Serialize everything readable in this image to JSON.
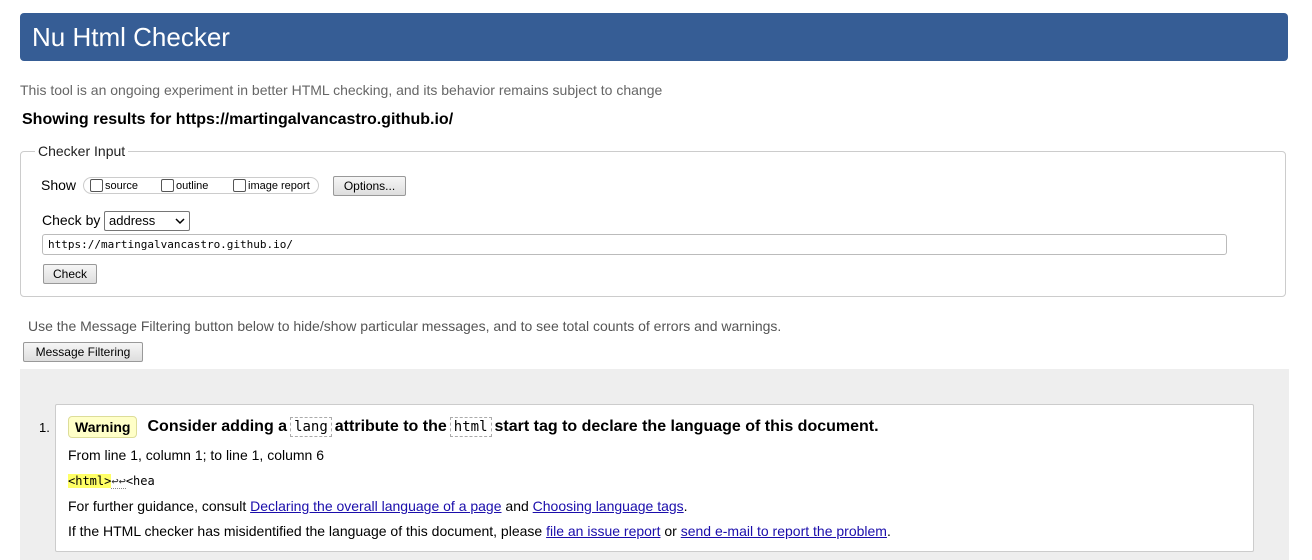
{
  "header": {
    "title": "Nu Html Checker"
  },
  "intro": "This tool is an ongoing experiment in better HTML checking, and its behavior remains subject to change",
  "showing": "Showing results for https://martingalvancastro.github.io/",
  "checker": {
    "legend": "Checker Input",
    "show_label": "Show",
    "options": [
      "source",
      "outline",
      "image report"
    ],
    "options_button": "Options...",
    "check_by_label": "Check by",
    "check_by_value": "address",
    "url_value": "https://martingalvancastro.github.io/",
    "check_button": "Check"
  },
  "filter": {
    "note": "Use the Message Filtering button below to hide/show particular messages, and to see total counts of errors and warnings.",
    "button": "Message Filtering"
  },
  "message": {
    "number": "1.",
    "badge": "Warning",
    "title_a": "Consider adding a",
    "code_a": "lang",
    "title_b": "attribute to the",
    "code_b": "html",
    "title_c": "start tag to declare the language of this document.",
    "location": "From line 1, column 1; to line 1, column 6",
    "extract_hl": "<html>",
    "extract_ret": "↩↩",
    "extract_rest": "<hea",
    "guidance_a": "For further guidance, consult",
    "guidance_link1": "Declaring the overall language of a page",
    "guidance_b": "and",
    "guidance_link2": "Choosing language tags",
    "guidance_c": ".",
    "issue_a": "If the HTML checker has misidentified the language of this document, please",
    "issue_link1": "file an issue report",
    "issue_b": "or",
    "issue_link2": "send e-mail to report the problem",
    "issue_c": "."
  }
}
